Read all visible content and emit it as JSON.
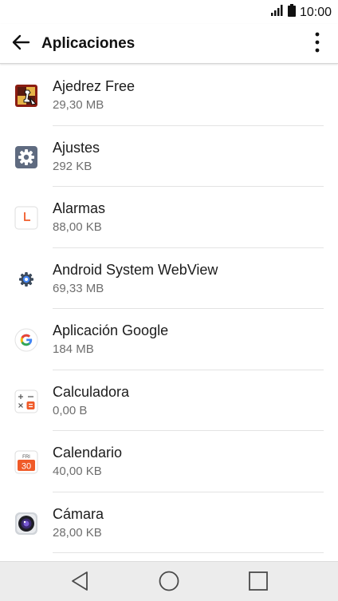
{
  "status_bar": {
    "time": "10:00",
    "signal_icon": "signal-icon",
    "battery_icon": "battery-icon"
  },
  "header": {
    "title": "Aplicaciones",
    "back_icon": "arrow-back-icon",
    "menu_icon": "more-vert-icon"
  },
  "apps": [
    {
      "name": "Ajedrez Free",
      "size": "29,30 MB",
      "icon": "chess-icon"
    },
    {
      "name": "Ajustes",
      "size": "292 KB",
      "icon": "settings-icon"
    },
    {
      "name": "Alarmas",
      "size": "88,00 KB",
      "icon": "clock-icon"
    },
    {
      "name": "Android System WebView",
      "size": "69,33 MB",
      "icon": "webview-gear-icon"
    },
    {
      "name": "Aplicación Google",
      "size": "184 MB",
      "icon": "google-icon"
    },
    {
      "name": "Calculadora",
      "size": "0,00 B",
      "icon": "calculator-icon"
    },
    {
      "name": "Calendario",
      "size": "40,00 KB",
      "icon": "calendar-icon",
      "icon_text": {
        "day": "FRI",
        "date": "30"
      }
    },
    {
      "name": "Cámara",
      "size": "28,00 KB",
      "icon": "camera-icon"
    }
  ],
  "nav_bar": {
    "back": "nav-back-icon",
    "home": "nav-home-icon",
    "recents": "nav-recents-icon"
  },
  "colors": {
    "accent_orange": "#f05a28",
    "google_blue": "#4285f4",
    "settings_gray": "#5f6b80",
    "nav_bg": "#ececec"
  }
}
